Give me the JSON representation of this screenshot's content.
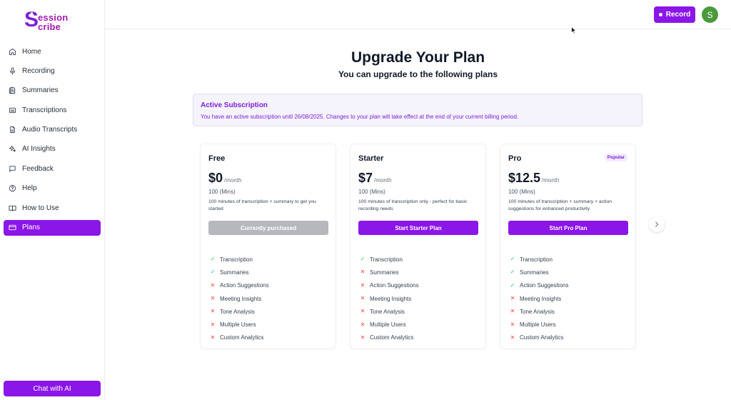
{
  "brand": {
    "logo_letter": "S",
    "logo_line1": "ession",
    "logo_line2": "cribe"
  },
  "sidebar": {
    "items": [
      {
        "label": "Home",
        "icon": "home-icon"
      },
      {
        "label": "Recording",
        "icon": "mic-icon"
      },
      {
        "label": "Summaries",
        "icon": "document-list-icon"
      },
      {
        "label": "Transcriptions",
        "icon": "caption-icon"
      },
      {
        "label": "Audio Transcripts",
        "icon": "file-text-icon"
      },
      {
        "label": "AI Insights",
        "icon": "sparkles-icon"
      },
      {
        "label": "Feedback",
        "icon": "message-square-icon"
      },
      {
        "label": "Help",
        "icon": "help-circle-icon"
      },
      {
        "label": "How to Use",
        "icon": "book-open-icon"
      },
      {
        "label": "Plans",
        "icon": "credit-card-icon",
        "active": true
      }
    ],
    "chat_label": "Chat with AI"
  },
  "header": {
    "record_label": "Record",
    "avatar_initial": "S"
  },
  "main": {
    "title": "Upgrade Your Plan",
    "subtitle": "You can upgrade to the following plans",
    "banner": {
      "title": "Active Subscription",
      "text": "You have an active subscription until 26/08/2025. Changes to your plan will take effect at the end of your current billing period."
    },
    "plans": [
      {
        "name": "Free",
        "badge": "",
        "price": "$0",
        "per": "/month",
        "mins": "100 (Mins)",
        "desc": "100 minutes of transcription + summary to get you started",
        "cta": "Currently purchased",
        "cta_disabled": true,
        "features": [
          {
            "label": "Transcription",
            "included": true
          },
          {
            "label": "Summaries",
            "included": true
          },
          {
            "label": "Action Suggestions",
            "included": false
          },
          {
            "label": "Meeting Insights",
            "included": false
          },
          {
            "label": "Tone Analysis",
            "included": false
          },
          {
            "label": "Multiple Users",
            "included": false
          },
          {
            "label": "Custom Analytics",
            "included": false
          }
        ]
      },
      {
        "name": "Starter",
        "badge": "",
        "price": "$7",
        "per": "/month",
        "mins": "100 (Mins)",
        "desc": "100 minutes of transcription only - perfect for basic recording needs",
        "cta": "Start Starter Plan",
        "cta_disabled": false,
        "features": [
          {
            "label": "Transcription",
            "included": true
          },
          {
            "label": "Summaries",
            "included": false
          },
          {
            "label": "Action Suggestions",
            "included": false
          },
          {
            "label": "Meeting Insights",
            "included": false
          },
          {
            "label": "Tone Analysis",
            "included": false
          },
          {
            "label": "Multiple Users",
            "included": false
          },
          {
            "label": "Custom Analytics",
            "included": false
          }
        ]
      },
      {
        "name": "Pro",
        "badge": "Popular",
        "price": "$12.5",
        "per": "/month",
        "mins": "100 (Mins)",
        "desc": "100 minutes of transcription + summary + action suggestions for enhanced productivity",
        "cta": "Start Pro Plan",
        "cta_disabled": false,
        "features": [
          {
            "label": "Transcription",
            "included": true
          },
          {
            "label": "Summaries",
            "included": true
          },
          {
            "label": "Action Suggestions",
            "included": true
          },
          {
            "label": "Meeting Insights",
            "included": false
          },
          {
            "label": "Tone Analysis",
            "included": false
          },
          {
            "label": "Multiple Users",
            "included": false
          },
          {
            "label": "Custom Analytics",
            "included": false
          }
        ]
      }
    ],
    "next_icon": "chevron-right-icon"
  },
  "colors": {
    "accent": "#8b16e8",
    "check": "#22c55e",
    "cross": "#ef4444",
    "banner_text": "#7c1fd3"
  }
}
